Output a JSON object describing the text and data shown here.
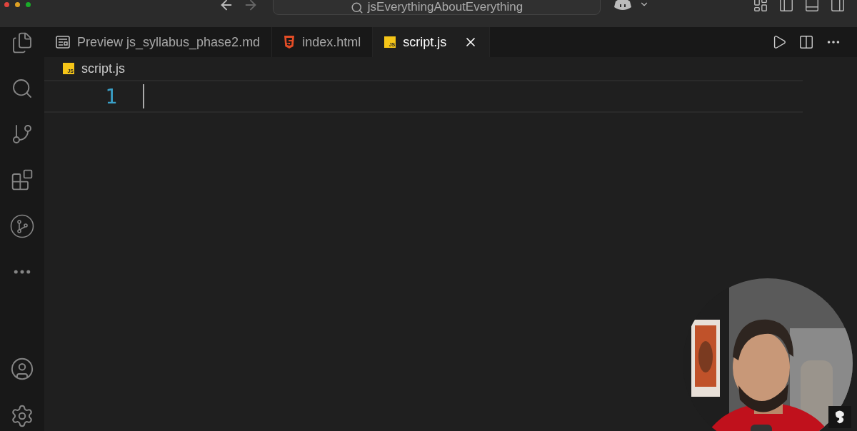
{
  "title_bar": {
    "search": "jsEverythingAboutEverything"
  },
  "tabs": [
    {
      "label": "Preview js_syllabus_phase2.md",
      "kind": "preview",
      "selected": false
    },
    {
      "label": "index.html",
      "kind": "html",
      "selected": false
    },
    {
      "label": "script.js",
      "kind": "js",
      "badge": "JS",
      "selected": true
    }
  ],
  "breadcrumb": {
    "file": "script.js",
    "badge": "JS"
  },
  "editor": {
    "lines": [
      {
        "number": "1",
        "current": true
      }
    ]
  }
}
